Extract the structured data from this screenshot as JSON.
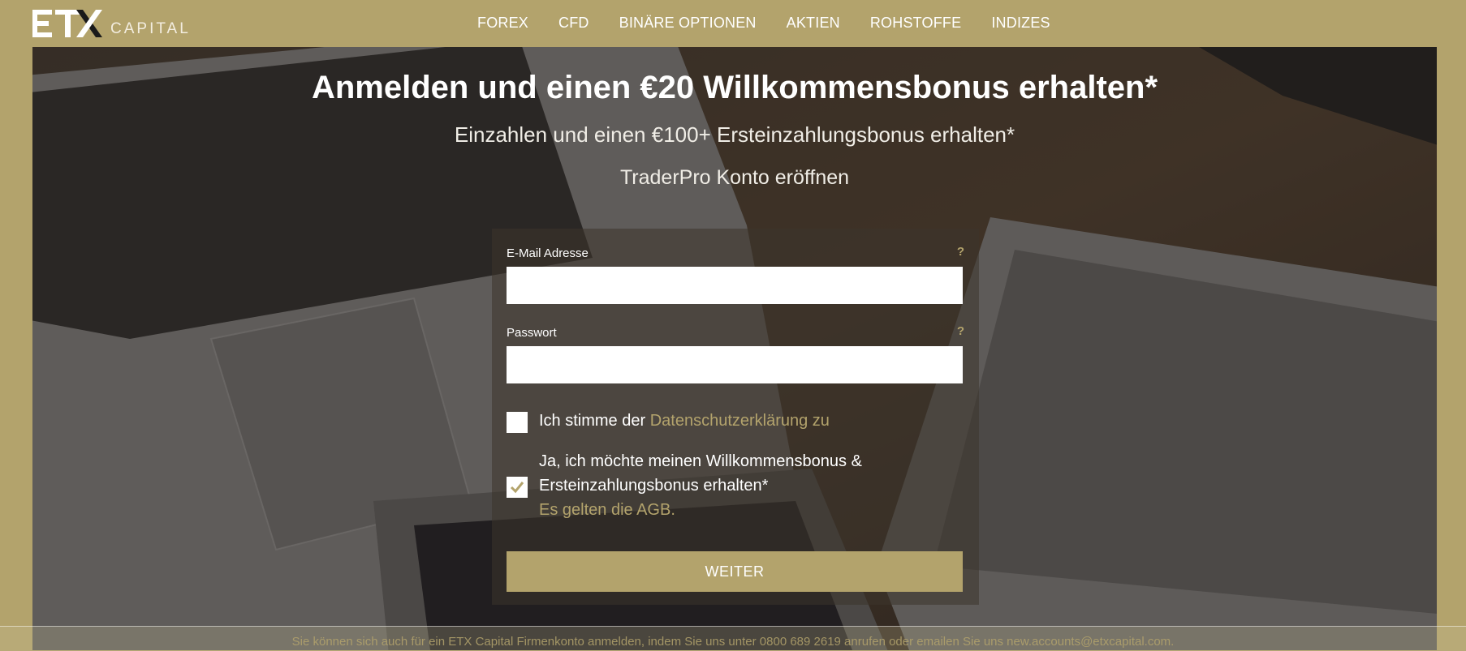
{
  "brand": {
    "logo_text": "ETX",
    "capital_label": "CAPITAL"
  },
  "nav": {
    "items": [
      "FOREX",
      "CFD",
      "BINÄRE OPTIONEN",
      "AKTIEN",
      "ROHSTOFFE",
      "INDIZES"
    ]
  },
  "hero": {
    "title": "Anmelden und einen €20 Willkommensbonus erhalten*",
    "subtitle": "Einzahlen und einen €100+ Ersteinzahlungsbonus erhalten*",
    "account": "TraderPro Konto eröffnen"
  },
  "form": {
    "email_label": "E-Mail Adresse",
    "email_value": "",
    "password_label": "Passwort",
    "password_value": "",
    "help_symbol": "?",
    "privacy_prefix": "Ich stimme der ",
    "privacy_link": "Datenschutzerklärung zu",
    "privacy_checked": false,
    "bonus_line1": "Ja, ich möchte meinen Willkommensbonus &",
    "bonus_line2": "Ersteinzahlungsbonus erhalten*",
    "bonus_terms": "Es gelten die AGB.",
    "bonus_checked": true,
    "submit_label": "WEITER"
  },
  "footer": {
    "note": "Sie können sich auch für ein ETX Capital Firmenkonto anmelden, indem Sie uns unter 0800 689 2619 anrufen oder emailen Sie uns new.accounts@etxcapital.com."
  },
  "colors": {
    "accent": "#b3a36c",
    "white": "#ffffff"
  }
}
